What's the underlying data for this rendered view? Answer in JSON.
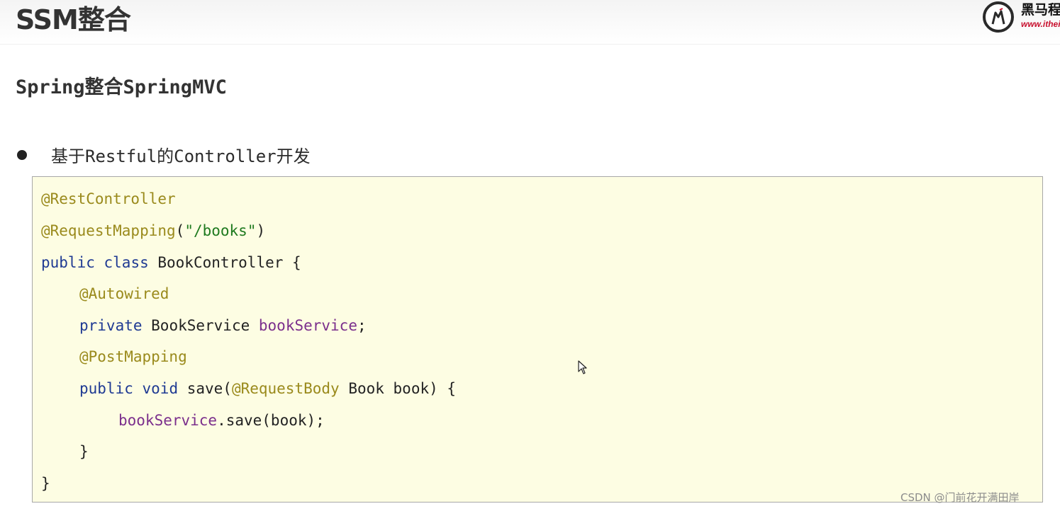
{
  "header": {
    "title": "SSM整合",
    "logo": {
      "name": "黑马程序员",
      "url": "www.itheima.com"
    }
  },
  "main": {
    "subtitle": "Spring整合SpringMVC",
    "bullet": "基于Restful的Controller开发",
    "code": {
      "l1": "@RestController",
      "l2_ann": "@RequestMapping",
      "l2_open": "(",
      "l2_str": "\"/books\"",
      "l2_close": ")",
      "l3_kw1": "public",
      "l3_kw2": "class",
      "l3_rest": " BookController {",
      "l4": "@Autowired",
      "l5_kw": "private",
      "l5_type": " BookService ",
      "l5_field": "bookService",
      "l5_end": ";",
      "l6": "@PostMapping",
      "l7_kw1": "public",
      "l7_kw2": "void",
      "l7_method": " save(",
      "l7_ann": "@RequestBody",
      "l7_rest": " Book book) {",
      "l8_field": "bookService",
      "l8_rest": ".save(book);",
      "l9": "}",
      "l10": "}"
    }
  },
  "watermark": "CSDN @门前花开满田岸",
  "colors": {
    "annotation": "#9a8a1c",
    "keyword": "#1f3a93",
    "string": "#1f7a1f",
    "field": "#7b2f8c",
    "code_background": "#fdfde3"
  }
}
